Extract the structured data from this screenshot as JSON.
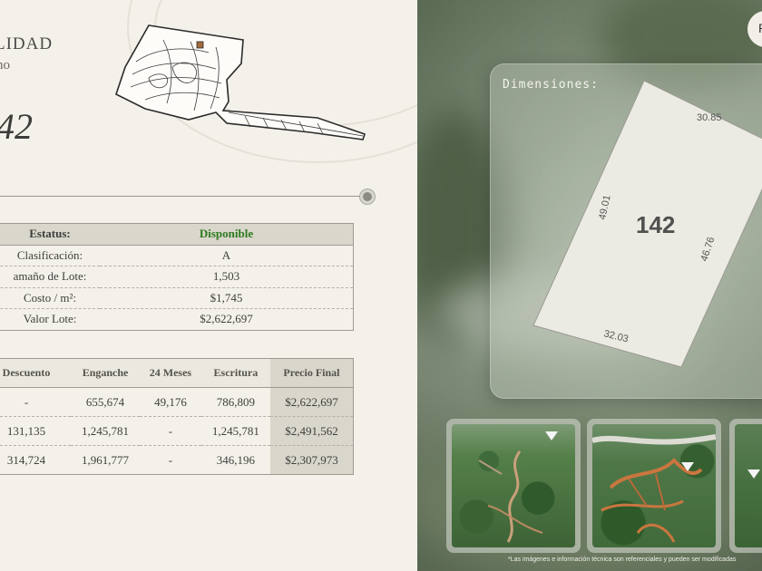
{
  "header": {
    "title": "LIDAD",
    "subtitle": "no",
    "lot_number": "42"
  },
  "info_table": {
    "status_label": "Estatus:",
    "status_value": "Disponible",
    "rows": [
      {
        "label": "Clasificación:",
        "value": "A"
      },
      {
        "label": "amaño de Lote:",
        "value": "1,503"
      },
      {
        "label": "Costo / m²:",
        "value": "$1,745"
      },
      {
        "label": "Valor Lote:",
        "value": "$2,622,697"
      }
    ]
  },
  "plans_table": {
    "headers": [
      "Descuento",
      "Enganche",
      "24 Meses",
      "Escritura",
      "Precio Final"
    ],
    "rows": [
      [
        "-",
        "655,674",
        "49,176",
        "786,809",
        "$2,622,697"
      ],
      [
        "131,135",
        "1,245,781",
        "-",
        "1,245,781",
        "$2,491,562"
      ],
      [
        "314,724",
        "1,961,777",
        "-",
        "346,196",
        "$2,307,973"
      ]
    ]
  },
  "dimensions": {
    "title": "Dimensiones:",
    "lot_label": "142",
    "top": "30.85",
    "left": "49.01",
    "right": "46.76",
    "bottom": "32.03"
  },
  "top_button_label": "P",
  "disclaimer": "*Las imágenes e información técnica son referenciales y pueden ser modificadas",
  "colors": {
    "status_available": "#2e7a20",
    "panel_bg": "#f4f1ea",
    "table_header": "#d9d6cb",
    "dirt_road": "#c9763f"
  }
}
